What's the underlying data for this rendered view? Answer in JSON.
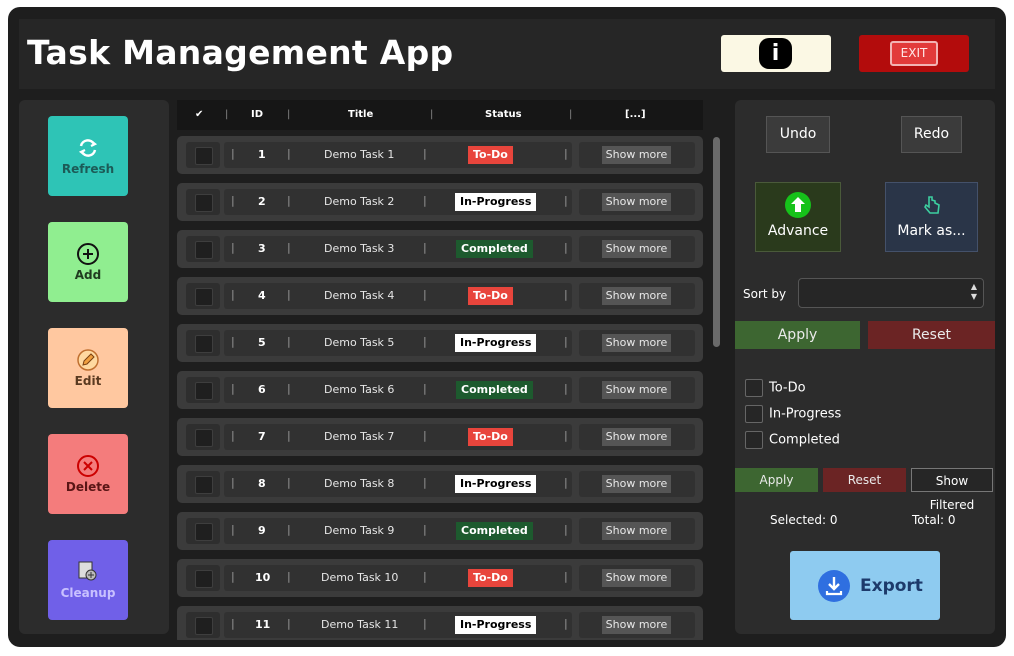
{
  "app": {
    "title": "Task Management App",
    "exit_label": "EXIT",
    "info_glyph": "i"
  },
  "sidebar": {
    "items": [
      {
        "label": "Refresh",
        "icon": "refresh-icon",
        "color": "#2ec4b6"
      },
      {
        "label": "Add",
        "icon": "plus-circle-icon",
        "color": "#90ee90"
      },
      {
        "label": "Edit",
        "icon": "pencil-icon",
        "color": "#ffc8a0"
      },
      {
        "label": "Delete",
        "icon": "x-circle-icon",
        "color": "#f47c7c"
      },
      {
        "label": "Cleanup",
        "icon": "cleanup-icon",
        "color": "#7060e8"
      }
    ]
  },
  "table": {
    "columns": [
      "ID",
      "Title",
      "Status",
      "[...]"
    ],
    "check_header": "✔",
    "rows": [
      {
        "id": "1",
        "title": "Demo Task 1",
        "status": "To-Do",
        "action": "Show more"
      },
      {
        "id": "2",
        "title": "Demo Task 2",
        "status": "In-Progress",
        "action": "Show more"
      },
      {
        "id": "3",
        "title": "Demo Task 3",
        "status": "Completed",
        "action": "Show more"
      },
      {
        "id": "4",
        "title": "Demo Task 4",
        "status": "To-Do",
        "action": "Show more"
      },
      {
        "id": "5",
        "title": "Demo Task 5",
        "status": "In-Progress",
        "action": "Show more"
      },
      {
        "id": "6",
        "title": "Demo Task 6",
        "status": "Completed",
        "action": "Show more"
      },
      {
        "id": "7",
        "title": "Demo Task 7",
        "status": "To-Do",
        "action": "Show more"
      },
      {
        "id": "8",
        "title": "Demo Task 8",
        "status": "In-Progress",
        "action": "Show more"
      },
      {
        "id": "9",
        "title": "Demo Task 9",
        "status": "Completed",
        "action": "Show more"
      },
      {
        "id": "10",
        "title": "Demo Task 10",
        "status": "To-Do",
        "action": "Show more"
      },
      {
        "id": "11",
        "title": "Demo Task 11",
        "status": "In-Progress",
        "action": "Show more"
      }
    ]
  },
  "right": {
    "undo": "Undo",
    "redo": "Redo",
    "advance": "Advance",
    "mark_as": "Mark as...",
    "sort_label": "Sort by",
    "sort_value": "",
    "apply": "Apply",
    "reset": "Reset",
    "filters": [
      "To-Do",
      "In-Progress",
      "Completed"
    ],
    "apply2": "Apply",
    "reset2": "Reset",
    "show_filtered": "Show Filtered",
    "selected": "Selected: 0",
    "total": "Total: 0",
    "export": "Export"
  }
}
